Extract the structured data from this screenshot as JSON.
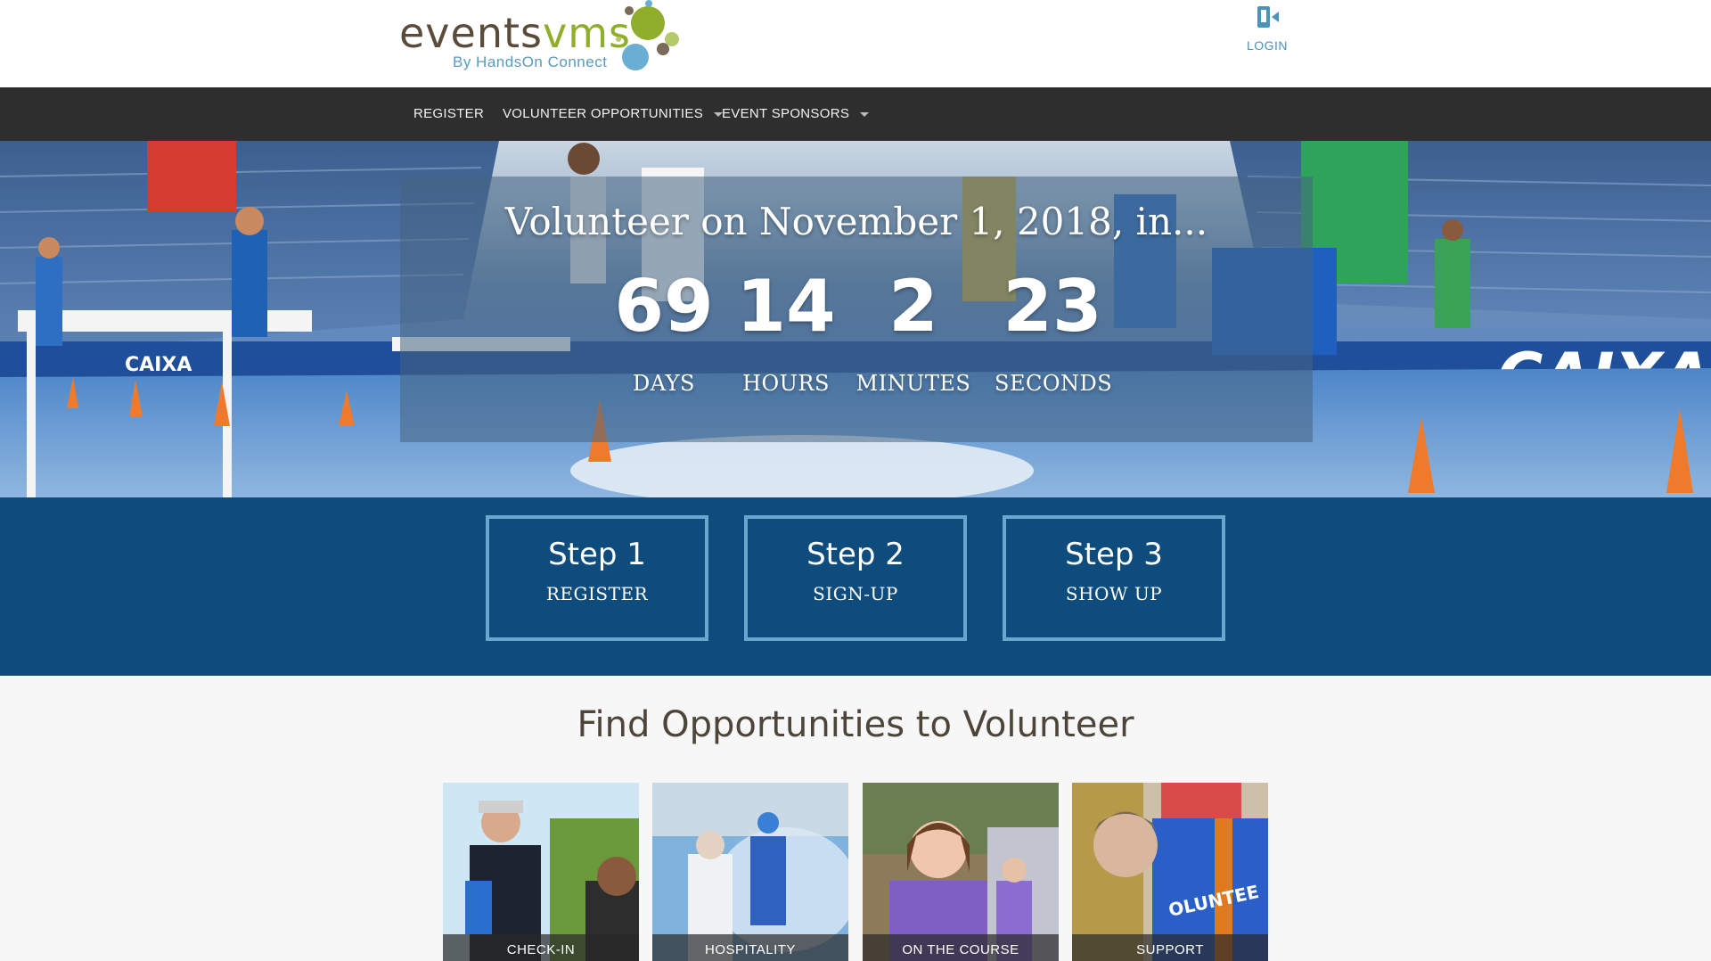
{
  "header": {
    "logo_word_events": "events",
    "logo_word_vms": "vms",
    "logo_tagline": "By HandsOn Connect",
    "login_label": "LOGIN"
  },
  "nav": {
    "items": [
      {
        "label": "REGISTER"
      },
      {
        "label": "VOLUNTEER OPPORTUNITIES"
      },
      {
        "label": "EVENT SPONSORS"
      }
    ]
  },
  "hero": {
    "headline": "Volunteer on November 1, 2018, in...",
    "countdown": [
      {
        "value": "69",
        "label": "DAYS"
      },
      {
        "value": "14",
        "label": "HOURS"
      },
      {
        "value": "2",
        "label": "MINUTES"
      },
      {
        "value": "23",
        "label": "SECONDS"
      }
    ]
  },
  "steps": [
    {
      "title": "Step 1",
      "subtitle": "REGISTER"
    },
    {
      "title": "Step 2",
      "subtitle": "SIGN-UP"
    },
    {
      "title": "Step 3",
      "subtitle": "SHOW UP"
    }
  ],
  "opportunities": {
    "title": "Find Opportunities to Volunteer",
    "cards": [
      {
        "label": "CHECK-IN"
      },
      {
        "label": "HOSPITALITY"
      },
      {
        "label": "ON THE COURSE"
      },
      {
        "label": "SUPPORT"
      }
    ]
  },
  "colors": {
    "nav_bg": "#2e2e2e",
    "steps_bg": "#0f4c7e",
    "step_border": "#6aa7cf",
    "logo_green": "#8fae2b",
    "logo_blue": "#5a9bbd"
  }
}
